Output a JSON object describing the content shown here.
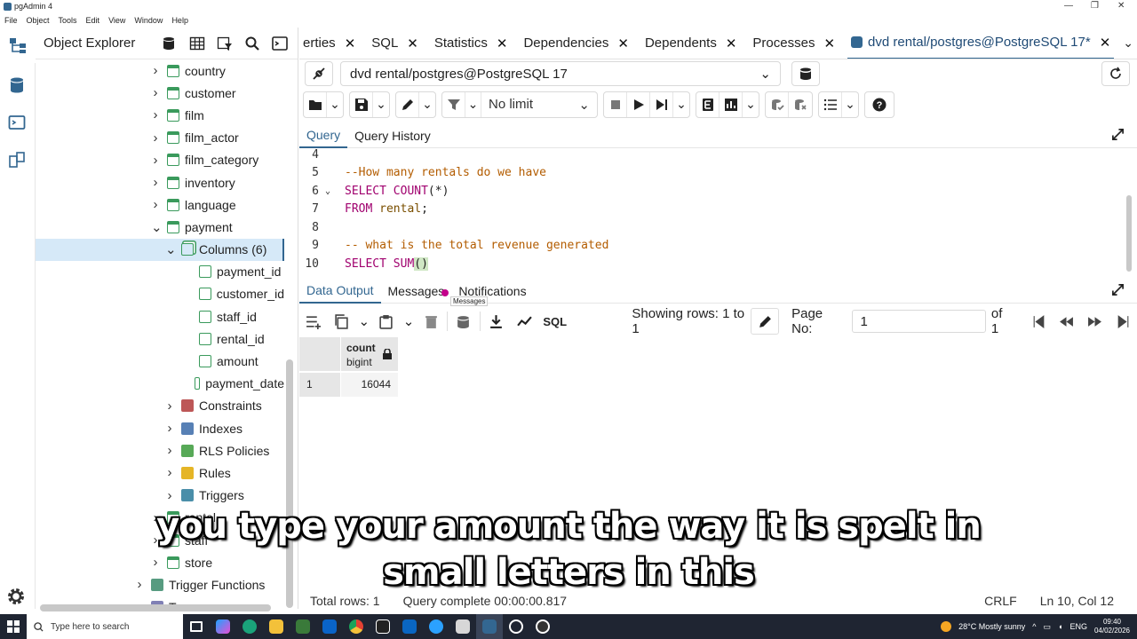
{
  "window": {
    "title": "pgAdmin 4"
  },
  "menu": [
    "File",
    "Object",
    "Tools",
    "Edit",
    "View",
    "Window",
    "Help"
  ],
  "explorer": {
    "title": "Object Explorer",
    "tree": [
      {
        "label": "country",
        "level": 0,
        "expanded": false,
        "icon": "table-icon"
      },
      {
        "label": "customer",
        "level": 0,
        "expanded": false,
        "icon": "table-icon"
      },
      {
        "label": "film",
        "level": 0,
        "expanded": false,
        "icon": "table-icon"
      },
      {
        "label": "film_actor",
        "level": 0,
        "expanded": false,
        "icon": "table-icon"
      },
      {
        "label": "film_category",
        "level": 0,
        "expanded": false,
        "icon": "table-icon"
      },
      {
        "label": "inventory",
        "level": 0,
        "expanded": false,
        "icon": "table-icon"
      },
      {
        "label": "language",
        "level": 0,
        "expanded": false,
        "icon": "table-icon"
      },
      {
        "label": "payment",
        "level": 0,
        "expanded": true,
        "icon": "table-icon"
      },
      {
        "label": "Columns",
        "count": "(6)",
        "level": 1,
        "expanded": true,
        "icon": "columns-icon",
        "selected": true
      },
      {
        "label": "payment_id",
        "level": 2,
        "icon": "column-icon"
      },
      {
        "label": "customer_id",
        "level": 2,
        "icon": "column-icon"
      },
      {
        "label": "staff_id",
        "level": 2,
        "icon": "column-icon"
      },
      {
        "label": "rental_id",
        "level": 2,
        "icon": "column-icon"
      },
      {
        "label": "amount",
        "level": 2,
        "icon": "column-icon"
      },
      {
        "label": "payment_date",
        "level": 2,
        "icon": "column-icon"
      },
      {
        "label": "Constraints",
        "level": 1,
        "expanded": false,
        "icon": "constraints-icon"
      },
      {
        "label": "Indexes",
        "level": 1,
        "expanded": false,
        "icon": "indexes-icon"
      },
      {
        "label": "RLS Policies",
        "level": 1,
        "expanded": false,
        "icon": "rls-policies-icon"
      },
      {
        "label": "Rules",
        "level": 1,
        "expanded": false,
        "icon": "rules-icon"
      },
      {
        "label": "Triggers",
        "level": 1,
        "expanded": false,
        "icon": "triggers-icon"
      },
      {
        "label": "rental",
        "level": 0,
        "expanded": false,
        "icon": "table-icon"
      },
      {
        "label": "staff",
        "level": 0,
        "expanded": false,
        "icon": "table-icon"
      },
      {
        "label": "store",
        "level": 0,
        "expanded": false,
        "icon": "table-icon"
      },
      {
        "label": "Trigger Functions",
        "level": -1,
        "expanded": false,
        "icon": "trigger-functions-icon"
      },
      {
        "label": "Types",
        "level": -1,
        "expanded": false,
        "icon": "types-icon"
      }
    ]
  },
  "tabs": [
    {
      "label": "erties",
      "closable": true
    },
    {
      "label": "SQL",
      "closable": true
    },
    {
      "label": "Statistics",
      "closable": true
    },
    {
      "label": "Dependencies",
      "closable": true
    },
    {
      "label": "Dependents",
      "closable": true
    },
    {
      "label": "Processes",
      "closable": true
    },
    {
      "label": "dvd rental/postgres@PostgreSQL 17*",
      "closable": true,
      "active": true
    }
  ],
  "connection": {
    "value": "dvd rental/postgres@PostgreSQL 17"
  },
  "toolbar": {
    "limit": "No limit"
  },
  "query_tabs": [
    "Query",
    "Query History"
  ],
  "editor_lines": [
    {
      "n": "4",
      "segments": []
    },
    {
      "n": "5",
      "segments": [
        {
          "t": "--How many rentals do we have",
          "c": "cm"
        }
      ]
    },
    {
      "n": "6",
      "fold": true,
      "segments": [
        {
          "t": "SELECT COUNT",
          "c": "kw"
        },
        {
          "t": "(*)",
          "c": ""
        }
      ]
    },
    {
      "n": "7",
      "segments": [
        {
          "t": "FROM ",
          "c": "kw"
        },
        {
          "t": "rental",
          "c": "id"
        },
        {
          "t": ";",
          "c": ""
        }
      ]
    },
    {
      "n": "8",
      "segments": []
    },
    {
      "n": "9",
      "segments": [
        {
          "t": "-- what is the total revenue generated",
          "c": "cm"
        }
      ]
    },
    {
      "n": "10",
      "segments": [
        {
          "t": "SELECT SUM",
          "c": "kw"
        },
        {
          "t": "()",
          "c": "hl"
        }
      ]
    }
  ],
  "output_tabs": [
    "Data Output",
    "Messages",
    "Notifications"
  ],
  "tooltip": "Messages",
  "data_toolbar": {
    "rows_info": "Showing rows: 1 to 1",
    "page_label": "Page No:",
    "page_value": "1",
    "of_label": "of 1"
  },
  "grid": {
    "column": {
      "name": "count",
      "type": "bigint"
    },
    "rows": [
      {
        "index": "1",
        "value": "16044"
      }
    ]
  },
  "status": {
    "total_rows": "Total rows: 1",
    "query_complete": "Query complete 00:00:00.817",
    "line_ending": "CRLF",
    "cursor": "Ln 10, Col 12"
  },
  "subtitle": [
    "you type your amount the way it is spelt in",
    "small letters in this"
  ],
  "taskbar": {
    "search_placeholder": "Type here to search",
    "weather": "28°C  Mostly sunny",
    "lang": "ENG",
    "time": "09:40",
    "date": "04/02/2026"
  }
}
